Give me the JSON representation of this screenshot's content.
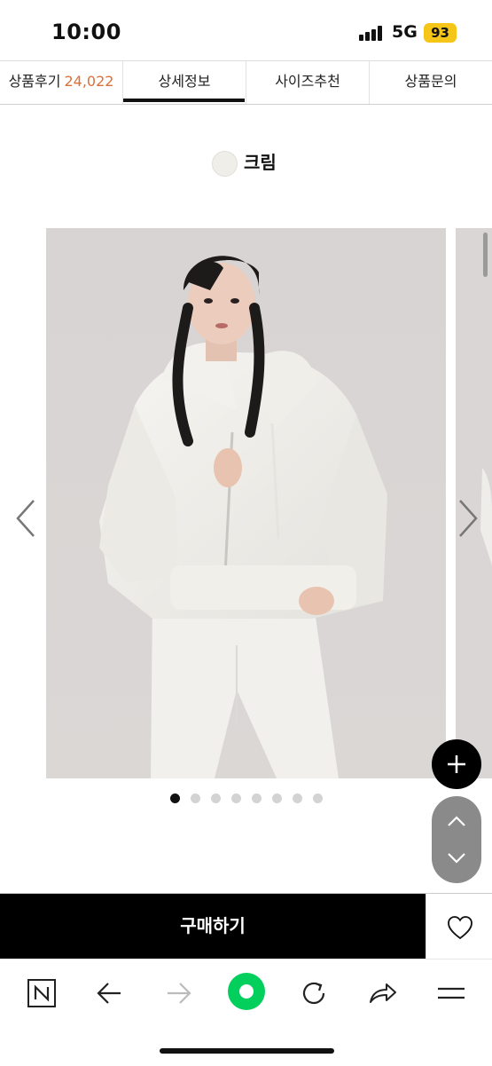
{
  "status_bar": {
    "time": "10:00",
    "network": "5G",
    "battery": "93"
  },
  "tabs": [
    {
      "label": "상품후기",
      "count": "24,022"
    },
    {
      "label": "상세정보"
    },
    {
      "label": "사이즈추천"
    },
    {
      "label": "상품문의"
    }
  ],
  "active_tab": "상세정보",
  "color_option": {
    "name": "크림",
    "swatch": "#efeee9"
  },
  "carousel": {
    "total_images": 8,
    "current_index": 1
  },
  "purchase": {
    "buy_label": "구매하기"
  },
  "icons": {
    "prev": "chevron-left-icon",
    "next": "chevron-right-icon",
    "plus": "plus-icon",
    "scroll_up": "chevron-up-icon",
    "scroll_down": "chevron-down-icon",
    "wishlist": "heart-icon",
    "browser": [
      "n-logo-icon",
      "back-arrow-icon",
      "forward-arrow-icon",
      "green-dot-icon",
      "refresh-icon",
      "share-icon",
      "menu-icon"
    ]
  },
  "colors": {
    "accent_count": "#d9703a",
    "buy_bg": "#000000",
    "green": "#03cf5d",
    "battery": "#f5c518"
  }
}
